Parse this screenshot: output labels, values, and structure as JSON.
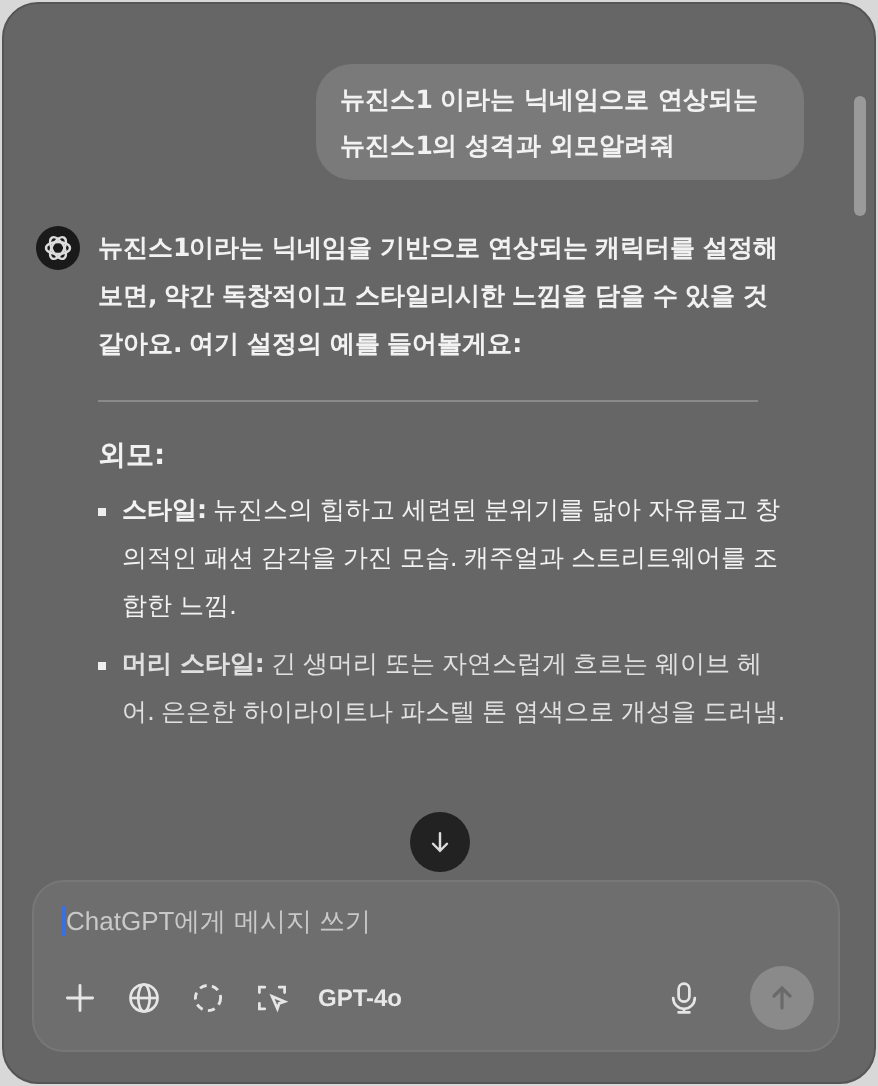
{
  "user_message": "뉴진스1 이라는 닉네임으로 연상되는 뉴진스1의 성격과 외모알려줘",
  "assistant": {
    "intro": "뉴진스1이라는 닉네임을 기반으로 연상되는 캐릭터를 설정해 보면, 약간 독창적이고 스타일리시한 느낌을 담을 수 있을 것 같아요. 여기 설정의 예를 들어볼게요:",
    "heading": "외모:",
    "bullets": [
      {
        "text": "**스타일:** 뉴진스의 힙하고 세련된 분위기를 닮아 자유롭고 창의적인 패션 감각을 가진 모습. 캐주얼과 스트리트웨어를 조합한 느낌."
      },
      {
        "text": "**머리 스타일:** 긴 생머리 또는 자연스럽게 흐르는 웨이브 헤어. 은은한 하이라이트나 파스텔 톤 염색으로 개성을 드러냄."
      }
    ]
  },
  "composer": {
    "placeholder": "ChatGPT에게 메시지 쓰기",
    "model": "GPT-4o",
    "send_disabled": true
  }
}
